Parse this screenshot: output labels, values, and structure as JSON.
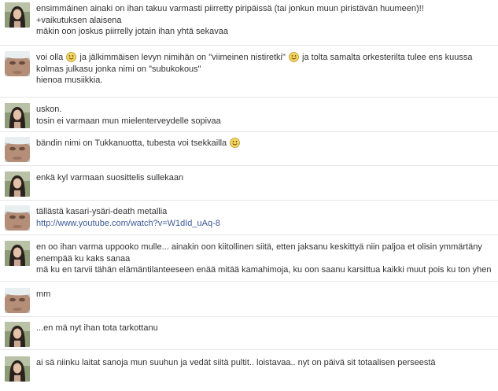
{
  "messages": [
    {
      "avatar": "female-avatar",
      "lines": [
        "ensimmäinen ainaki on ihan takuu varmasti piirretty piripäissä (tai jonkun muun piristävän huumeen)!!",
        "+vaikutuksen alaisena",
        "mäkin oon joskus piirrelly jotain ihan yhtä sekavaa"
      ]
    },
    {
      "avatar": "male-avatar",
      "segments": [
        "voi olla",
        " ja jälkimmäisen levyn nimihän on \"viimeinen nistiretki\"",
        " ja tolta samalta orkesterilta tulee ens kuussa kolmas julkasu jonka nimi on \"subukokous\""
      ],
      "lines": [
        "hienoa musiikkia."
      ]
    },
    {
      "avatar": "female-avatar",
      "lines": [
        "uskon.",
        "tosin ei varmaan mun mielenterveydelle sopivaa"
      ]
    },
    {
      "avatar": "male-avatar",
      "lines": [
        "bändin nimi on Tukkanuotta, tubesta voi tsekkailla"
      ]
    },
    {
      "avatar": "female-avatar",
      "lines": [
        "enkä kyl varmaan suosittelis sullekaan"
      ]
    },
    {
      "avatar": "male-avatar",
      "lines": [
        "tällästä kasari-ysäri-death metallia"
      ],
      "link": "http://www.youtube.com/watch?v=W1dId_uAq-8"
    },
    {
      "avatar": "female-avatar",
      "lines": [
        "en oo ihan varma uppooko mulle... ainakin oon kiitollinen siitä, etten jaksanu keskittyä niin paljoa et olisin ymmärtäny enempää ku kaks sanaa",
        "mä ku en tarvii tähän elämäntilanteeseen enää mitää kamahimoja, ku oon saanu karsittua kaikki muut pois ku ton yhen"
      ]
    },
    {
      "avatar": "male-avatar",
      "lines": [
        "mm"
      ]
    },
    {
      "avatar": "female-avatar",
      "lines": [
        "...en mä nyt ihan tota tarkottanu"
      ]
    },
    {
      "avatar": "female-avatar",
      "lines": [
        "ai sä niinku laitat sanoja mun suuhun ja vedät siitä pultit.. loistavaa.. nyt on päivä sit totaalisen perseestä"
      ]
    }
  ],
  "colors": {
    "link": "#3b5998",
    "divider": "#e6e6e6",
    "text": "#333333",
    "smiley": "#f3d560"
  },
  "icons": [
    "female-avatar",
    "male-avatar",
    "smiley-icon"
  ]
}
